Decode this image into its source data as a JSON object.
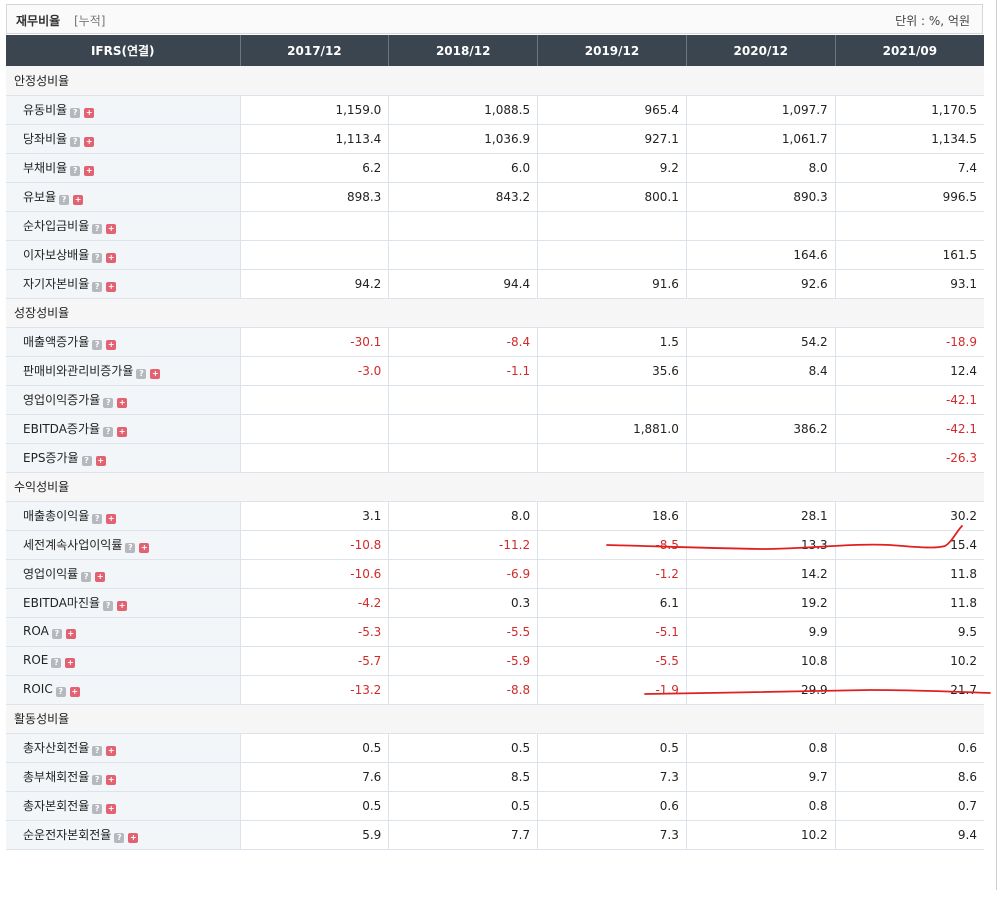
{
  "header": {
    "title": "재무비율",
    "subtitle": "[누적]",
    "unit": "단위 : %, 억원"
  },
  "table": {
    "columns": [
      "IFRS(연결)",
      "2017/12",
      "2018/12",
      "2019/12",
      "2020/12",
      "2021/09"
    ],
    "sections": [
      {
        "title": "안정성비율",
        "rows": [
          {
            "label": "유동비율",
            "values": [
              "1,159.0",
              "1,088.5",
              "965.4",
              "1,097.7",
              "1,170.5"
            ]
          },
          {
            "label": "당좌비율",
            "values": [
              "1,113.4",
              "1,036.9",
              "927.1",
              "1,061.7",
              "1,134.5"
            ]
          },
          {
            "label": "부채비율",
            "values": [
              "6.2",
              "6.0",
              "9.2",
              "8.0",
              "7.4"
            ]
          },
          {
            "label": "유보율",
            "values": [
              "898.3",
              "843.2",
              "800.1",
              "890.3",
              "996.5"
            ]
          },
          {
            "label": "순차입금비율",
            "values": [
              "",
              "",
              "",
              "",
              ""
            ]
          },
          {
            "label": "이자보상배율",
            "values": [
              "",
              "",
              "",
              "164.6",
              "161.5"
            ]
          },
          {
            "label": "자기자본비율",
            "values": [
              "94.2",
              "94.4",
              "91.6",
              "92.6",
              "93.1"
            ]
          }
        ]
      },
      {
        "title": "성장성비율",
        "rows": [
          {
            "label": "매출액증가율",
            "values": [
              "-30.1",
              "-8.4",
              "1.5",
              "54.2",
              "-18.9"
            ]
          },
          {
            "label": "판매비와관리비증가율",
            "values": [
              "-3.0",
              "-1.1",
              "35.6",
              "8.4",
              "12.4"
            ]
          },
          {
            "label": "영업이익증가율",
            "values": [
              "",
              "",
              "",
              "",
              "-42.1"
            ]
          },
          {
            "label": "EBITDA증가율",
            "values": [
              "",
              "",
              "1,881.0",
              "386.2",
              "-42.1"
            ]
          },
          {
            "label": "EPS증가율",
            "values": [
              "",
              "",
              "",
              "",
              "-26.3"
            ]
          }
        ]
      },
      {
        "title": "수익성비율",
        "rows": [
          {
            "label": "매출총이익율",
            "values": [
              "3.1",
              "8.0",
              "18.6",
              "28.1",
              "30.2"
            ]
          },
          {
            "label": "세전계속사업이익률",
            "values": [
              "-10.8",
              "-11.2",
              "-8.5",
              "13.3",
              "15.4"
            ]
          },
          {
            "label": "영업이익률",
            "values": [
              "-10.6",
              "-6.9",
              "-1.2",
              "14.2",
              "11.8"
            ]
          },
          {
            "label": "EBITDA마진율",
            "values": [
              "-4.2",
              "0.3",
              "6.1",
              "19.2",
              "11.8"
            ]
          },
          {
            "label": "ROA",
            "values": [
              "-5.3",
              "-5.5",
              "-5.1",
              "9.9",
              "9.5"
            ]
          },
          {
            "label": "ROE",
            "values": [
              "-5.7",
              "-5.9",
              "-5.5",
              "10.8",
              "10.2"
            ]
          },
          {
            "label": "ROIC",
            "values": [
              "-13.2",
              "-8.8",
              "-1.9",
              "29.9",
              "21.7"
            ]
          }
        ]
      },
      {
        "title": "활동성비율",
        "rows": [
          {
            "label": "총자산회전율",
            "values": [
              "0.5",
              "0.5",
              "0.5",
              "0.8",
              "0.6"
            ]
          },
          {
            "label": "총부채회전율",
            "values": [
              "7.6",
              "8.5",
              "7.3",
              "9.7",
              "8.6"
            ]
          },
          {
            "label": "총자본회전율",
            "values": [
              "0.5",
              "0.5",
              "0.6",
              "0.8",
              "0.7"
            ]
          },
          {
            "label": "순운전자본회전율",
            "values": [
              "5.9",
              "7.7",
              "7.3",
              "10.2",
              "9.4"
            ]
          }
        ]
      }
    ]
  },
  "icons": {
    "help": "help-icon",
    "expand": "plus-icon"
  },
  "colors": {
    "header_bg": "#3b4550",
    "negative": "#d12a2a",
    "annotation": "#e02020"
  }
}
